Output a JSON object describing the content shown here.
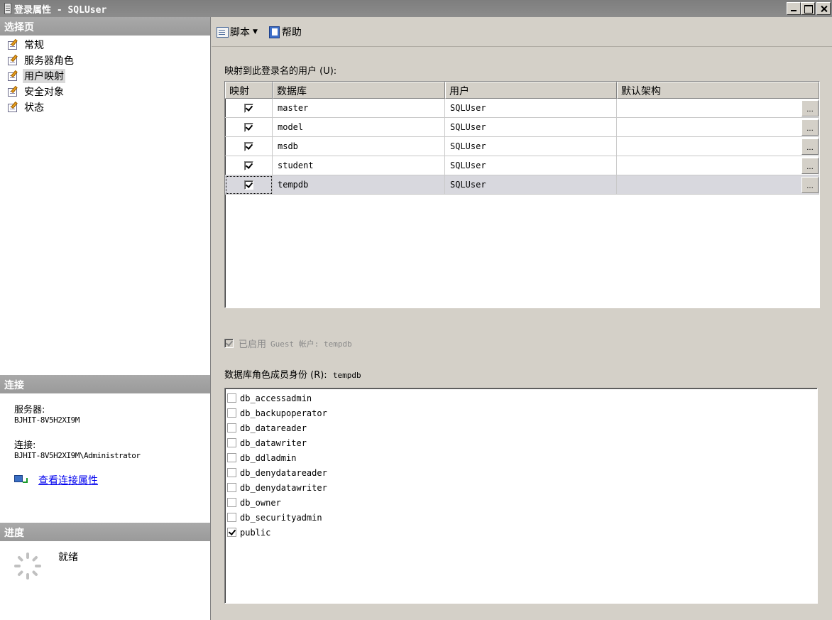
{
  "window": {
    "title": "登录属性 - SQLUser"
  },
  "left": {
    "select_header": "选择页",
    "pages": [
      {
        "label": "常规",
        "selected": false
      },
      {
        "label": "服务器角色",
        "selected": false
      },
      {
        "label": "用户映射",
        "selected": true
      },
      {
        "label": "安全对象",
        "selected": false
      },
      {
        "label": "状态",
        "selected": false
      }
    ],
    "connection": {
      "header": "连接",
      "server_label": "服务器:",
      "server_value": "BJHIT-8V5H2XI9M",
      "connection_label": "连接:",
      "connection_value": "BJHIT-8V5H2XI9M\\Administrator",
      "view_link": "查看连接属性"
    },
    "progress": {
      "header": "进度",
      "status": "就绪"
    }
  },
  "toolbar": {
    "script_label": "脚本",
    "help_label": "帮助"
  },
  "mapping": {
    "label": "映射到此登录名的用户 (U):",
    "columns": [
      "映射",
      "数据库",
      "用户",
      "默认架构"
    ],
    "rows": [
      {
        "mapped": true,
        "database": "master",
        "user": "SQLUser",
        "schema": ""
      },
      {
        "mapped": true,
        "database": "model",
        "user": "SQLUser",
        "schema": ""
      },
      {
        "mapped": true,
        "database": "msdb",
        "user": "SQLUser",
        "schema": ""
      },
      {
        "mapped": true,
        "database": "student",
        "user": "SQLUser",
        "schema": ""
      },
      {
        "mapped": true,
        "database": "tempdb",
        "user": "SQLUser",
        "schema": "",
        "selected": true
      }
    ],
    "ellipsis": "..."
  },
  "guest": {
    "label": "已启用",
    "detail": "Guest 帐户: tempdb",
    "checked": true
  },
  "roles": {
    "label": "数据库角色成员身份 (R):",
    "database": "tempdb",
    "items": [
      {
        "name": "db_accessadmin",
        "checked": false
      },
      {
        "name": "db_backupoperator",
        "checked": false
      },
      {
        "name": "db_datareader",
        "checked": false
      },
      {
        "name": "db_datawriter",
        "checked": false
      },
      {
        "name": "db_ddladmin",
        "checked": false
      },
      {
        "name": "db_denydatareader",
        "checked": false
      },
      {
        "name": "db_denydatawriter",
        "checked": false
      },
      {
        "name": "db_owner",
        "checked": false
      },
      {
        "name": "db_securityadmin",
        "checked": false
      },
      {
        "name": "public",
        "checked": true
      }
    ]
  }
}
